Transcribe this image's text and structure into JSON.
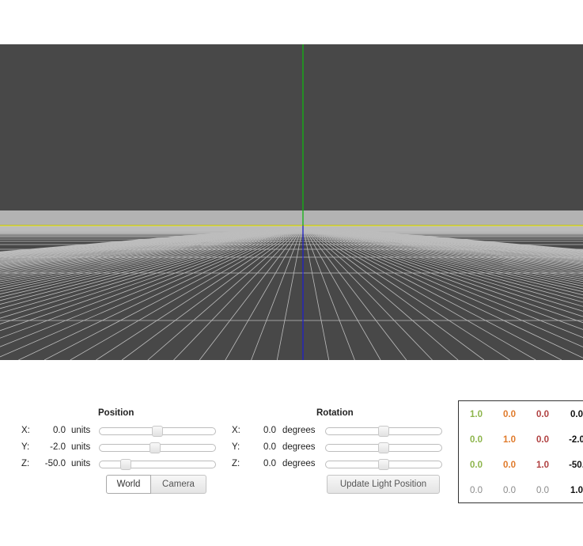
{
  "position": {
    "title": "Position",
    "rows": [
      {
        "axis": "X:",
        "value": "0.0",
        "unit": "units",
        "level": 0.5
      },
      {
        "axis": "Y:",
        "value": "-2.0",
        "unit": "units",
        "level": 0.48
      },
      {
        "axis": "Z:",
        "value": "-50.0",
        "unit": "units",
        "level": 0.2
      }
    ],
    "buttons": {
      "world": "World",
      "camera": "Camera"
    }
  },
  "rotation": {
    "title": "Rotation",
    "rows": [
      {
        "axis": "X:",
        "value": "0.0",
        "unit": "degrees",
        "level": 0.5
      },
      {
        "axis": "Y:",
        "value": "0.0",
        "unit": "degrees",
        "level": 0.5
      },
      {
        "axis": "Z:",
        "value": "0.0",
        "unit": "degrees",
        "level": 0.5
      }
    ],
    "update_button": "Update Light Position"
  },
  "matrix": [
    [
      "1.0",
      "0.0",
      "0.0",
      "0.0"
    ],
    [
      "0.0",
      "1.0",
      "0.0",
      "-2.0"
    ],
    [
      "0.0",
      "0.0",
      "1.0",
      "-50."
    ],
    [
      "0.0",
      "0.0",
      "0.0",
      "1.0"
    ]
  ],
  "colors": {
    "viewport_bg": "#484848",
    "horizon_band": "#b3b3b3",
    "grid_lines": "#bdbdbd",
    "y_axis_up": "#12b512",
    "z_axis_down": "#2020c8",
    "horizon_line": "#e6e632"
  }
}
